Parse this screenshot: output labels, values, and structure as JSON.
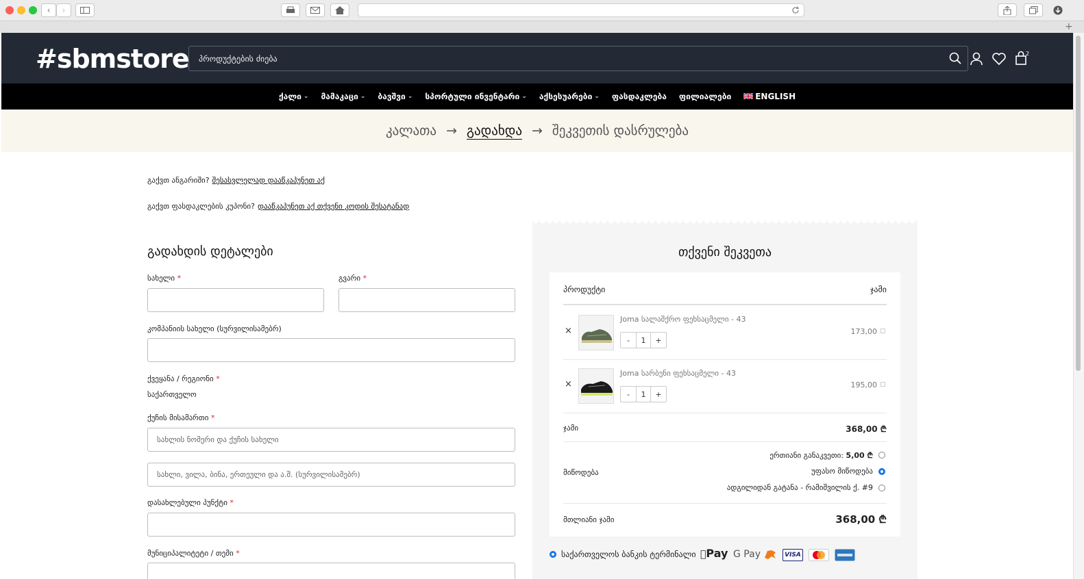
{
  "site": {
    "logo": "#sbmstore",
    "search_placeholder": "პროდუქტების ძიება",
    "cart_count": "2"
  },
  "nav": [
    {
      "label": "ქალი",
      "has_dropdown": true
    },
    {
      "label": "მამაკაცი",
      "has_dropdown": true
    },
    {
      "label": "ბავშვი",
      "has_dropdown": true
    },
    {
      "label": "სპორტული ინვენტარი",
      "has_dropdown": true
    },
    {
      "label": "აქსესუარები",
      "has_dropdown": true
    },
    {
      "label": "ფასდაკლება",
      "has_dropdown": false
    },
    {
      "label": "ფილიალები",
      "has_dropdown": false
    },
    {
      "label": "ENGLISH",
      "has_dropdown": false
    }
  ],
  "breadcrumb": {
    "step1": "კალათა",
    "step2": "გადახდა",
    "step3": "შეკვეთის დასრულება",
    "arrow": "→"
  },
  "notices": {
    "account_q": "გაქვთ ანგარიში?",
    "account_link": "შესასვლელად დააწკაპუნეთ აქ",
    "coupon_q": "გაქვთ ფასდაკლების კუპონი?",
    "coupon_link": "დააწკაპუნეთ აქ თქვენი კოდის შესატანად"
  },
  "billing": {
    "title": "გადახდის დეტალები",
    "first_name": "სახელი",
    "last_name": "გვარი",
    "company": "კომპანიის სახელი (სურვილისამებრ)",
    "country_label": "ქვეყანა / რეგიონი",
    "country_value": "საქართველო",
    "street_label": "ქუჩის მისამართი",
    "street_ph1": "სახლის ნომერი და ქუჩის სახელი",
    "street_ph2": "სახლი, ვილა, ბინა, ერთეული და ა.შ. (სურვილისამებრ)",
    "city_label": "დასახლებული პუნქტი",
    "municipality_label": "მუნიციპალიტეტი / თემი",
    "required_mark": "*"
  },
  "order": {
    "title": "თქვენი შეკვეთა",
    "col_product": "პროდუქტი",
    "col_total": "ჯამი",
    "items": [
      {
        "name": "Joma სალაშქრო ფეხსაცმელი - 43",
        "qty": "1",
        "price": "173,00",
        "remove": "×"
      },
      {
        "name": "Joma სარბენი ფეხსაცმელი - 43",
        "qty": "1",
        "price": "195,00",
        "remove": "×"
      }
    ],
    "qty_minus": "-",
    "qty_plus": "+",
    "subtotal_label": "ჯამი",
    "subtotal_value": "368,00 ₾",
    "shipping_label": "მიწოდება",
    "shipping_options": [
      {
        "label": "ერთიანი განაკვეთი:",
        "price": "5,00 ₾",
        "selected": false
      },
      {
        "label": "უფასო მიწოდება",
        "price": "",
        "selected": true
      },
      {
        "label": "ადგილიდან გატანა - რამიშვილის ქ. #9",
        "price": "",
        "selected": false
      }
    ],
    "total_label": "მთლიანი ჯამი",
    "total_value": "368,00 ₾",
    "payment_method": "საქართველოს ბანკის ტერმინალი",
    "payment_logos": [
      "Pay",
      "G Pay",
      "VISA"
    ]
  }
}
